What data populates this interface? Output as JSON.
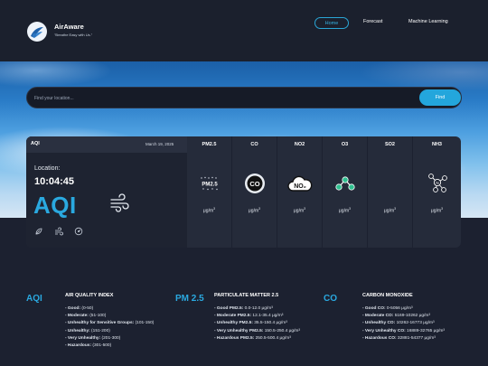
{
  "brand": {
    "name": "AirAware",
    "tagline": "\"Breathe Easy with Us.\""
  },
  "nav": {
    "home": "Home",
    "forecast": "Forecast",
    "ml": "Machine Learning"
  },
  "search": {
    "placeholder": "Find your location...",
    "button": "Find"
  },
  "aqi_card": {
    "header": "AQI",
    "date": "March 19, 2025",
    "location_label": "Location:",
    "time": "10:04:45",
    "aqi_label": "AQI"
  },
  "pollutants": [
    {
      "name": "PM2.5",
      "icon": "pm25-icon",
      "unit": "μg/m",
      "unit_sup": "3"
    },
    {
      "name": "CO",
      "icon": "co-icon",
      "unit": "μg/m",
      "unit_sup": "3"
    },
    {
      "name": "NO2",
      "icon": "no2-icon",
      "unit": "μg/m",
      "unit_sup": "3"
    },
    {
      "name": "O3",
      "icon": "o3-icon",
      "unit": "μg/m",
      "unit_sup": "3"
    },
    {
      "name": "SO2",
      "icon": "so2-icon",
      "unit": "μg/m",
      "unit_sup": "3"
    },
    {
      "name": "NH3",
      "icon": "nh3-icon",
      "unit": "μg/m",
      "unit_sup": "3"
    }
  ],
  "info": [
    {
      "abbr": "AQI",
      "title": "AIR QUALITY INDEX",
      "items": [
        {
          "label": "- Good:",
          "value": " (0-50)"
        },
        {
          "label": "- Moderate:",
          "value": " (51-100)"
        },
        {
          "label": "- Unhealthy for Sensitive Groups:",
          "value": " (101-150)"
        },
        {
          "label": "- Unhealthy:",
          "value": " (151-200)"
        },
        {
          "label": "- Very Unhealthy:",
          "value": " (201-300)"
        },
        {
          "label": "- Hazardous:",
          "value": " (301-500)"
        }
      ]
    },
    {
      "abbr": "PM 2.5",
      "title": "PARTICULATE MATTER 2.5",
      "items": [
        {
          "label": "- Good PM2.5:",
          "value": " 0.0-12.0 μg/m³"
        },
        {
          "label": "- Moderate PM2.5:",
          "value": " 12.1-35.4 μg/m³"
        },
        {
          "label": "- Unhealthy PM2.5:",
          "value": " 35.5-150.4 μg/m³"
        },
        {
          "label": "- Very Unhealthy PM2.5:",
          "value": " 150.5-250.4 μg/m³"
        },
        {
          "label": "- Hazardous PM2.5:",
          "value": " 250.5-500.4 μg/m³"
        }
      ]
    },
    {
      "abbr": "CO",
      "title": "CARBON MONOXIDE",
      "items": [
        {
          "label": "- Good CO:",
          "value": " 0-5056 μg/m³"
        },
        {
          "label": "- Moderate CO:",
          "value": " 5169-10262 μg/m³"
        },
        {
          "label": "- Unhealthy CO:",
          "value": " 10262-16773 μg/m³"
        },
        {
          "label": "- Very Unhealthy CO:",
          "value": " 16889-32765 μg/m³"
        },
        {
          "label": "- Hazardous CO:",
          "value": " 32881-54377 μg/m³"
        }
      ]
    }
  ],
  "colors": {
    "accent": "#2aa9e0",
    "background": "#1c2130",
    "panel": "#252b3a"
  }
}
